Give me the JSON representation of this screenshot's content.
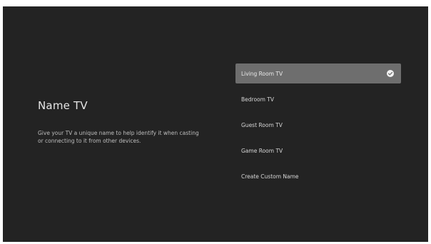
{
  "screen": {
    "title": "Name TV",
    "description": "Give your TV a unique name to help identify it when casting or connecting to it from other devices."
  },
  "options": [
    {
      "label": "Living Room TV",
      "selected": true,
      "icon": "check-circle-icon"
    },
    {
      "label": "Bedroom TV",
      "selected": false
    },
    {
      "label": "Guest Room TV",
      "selected": false
    },
    {
      "label": "Game Room TV",
      "selected": false
    },
    {
      "label": "Create Custom Name",
      "selected": false
    }
  ],
  "colors": {
    "background": "#232323",
    "selected_row": "#6e6e6e",
    "text": "#d7d7d7"
  }
}
